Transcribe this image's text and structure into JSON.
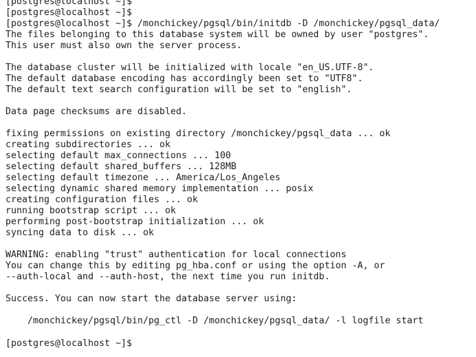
{
  "terminal": {
    "lines": [
      "[postgres@localhost ~]$",
      "[postgres@localhost ~]$",
      "[postgres@localhost ~]$ /monchickey/pgsql/bin/initdb -D /monchickey/pgsql_data/",
      "The files belonging to this database system will be owned by user \"postgres\".",
      "This user must also own the server process.",
      "",
      "The database cluster will be initialized with locale \"en_US.UTF-8\".",
      "The default database encoding has accordingly been set to \"UTF8\".",
      "The default text search configuration will be set to \"english\".",
      "",
      "Data page checksums are disabled.",
      "",
      "fixing permissions on existing directory /monchickey/pgsql_data ... ok",
      "creating subdirectories ... ok",
      "selecting default max_connections ... 100",
      "selecting default shared_buffers ... 128MB",
      "selecting default timezone ... America/Los_Angeles",
      "selecting dynamic shared memory implementation ... posix",
      "creating configuration files ... ok",
      "running bootstrap script ... ok",
      "performing post-bootstrap initialization ... ok",
      "syncing data to disk ... ok",
      "",
      "WARNING: enabling \"trust\" authentication for local connections",
      "You can change this by editing pg_hba.conf or using the option -A, or",
      "--auth-local and --auth-host, the next time you run initdb.",
      "",
      "Success. You can now start the database server using:",
      "",
      "    /monchickey/pgsql/bin/pg_ctl -D /monchickey/pgsql_data/ -l logfile start",
      "",
      "[postgres@localhost ~]$"
    ]
  }
}
